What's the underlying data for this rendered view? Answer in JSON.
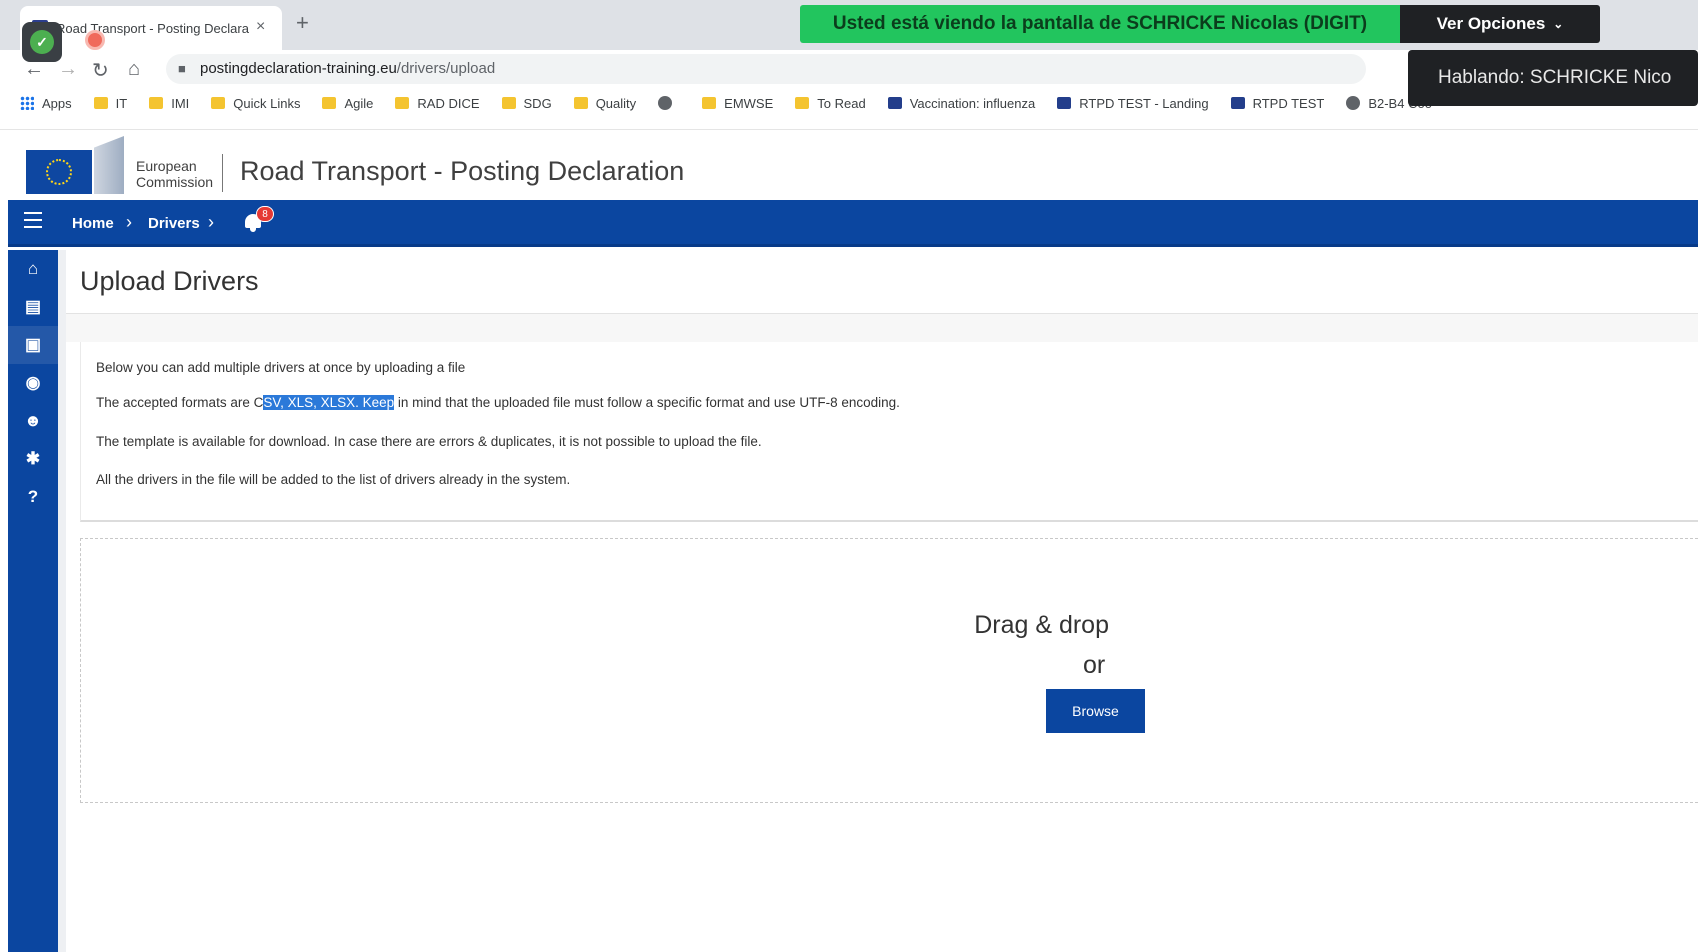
{
  "browser": {
    "tab_title": "Road Transport - Posting Declara",
    "tab_close": "×",
    "new_tab": "+",
    "url_host": "postingdeclaration-training.eu",
    "url_path": "/drivers/upload",
    "bookmarks": [
      {
        "label": "Apps",
        "icon": "apps-grid-icon"
      },
      {
        "label": "IT",
        "icon": "folder-icon"
      },
      {
        "label": "IMI",
        "icon": "folder-icon"
      },
      {
        "label": "Quick Links",
        "icon": "folder-icon"
      },
      {
        "label": "Agile",
        "icon": "folder-icon"
      },
      {
        "label": "RAD DICE",
        "icon": "folder-icon"
      },
      {
        "label": "SDG",
        "icon": "folder-icon"
      },
      {
        "label": "Quality",
        "icon": "folder-icon"
      },
      {
        "label": "",
        "icon": "globe-icon"
      },
      {
        "label": "EMWSE",
        "icon": "folder-icon"
      },
      {
        "label": "To Read",
        "icon": "folder-icon"
      },
      {
        "label": "Vaccination: influenza",
        "icon": "eu-flag-icon"
      },
      {
        "label": "RTPD TEST - Landing",
        "icon": "eu-flag-icon"
      },
      {
        "label": "RTPD TEST",
        "icon": "eu-flag-icon"
      },
      {
        "label": "B2-B4 Coo",
        "icon": "globe-icon"
      }
    ]
  },
  "screen_share": {
    "banner": "Usted está viendo la pantalla de SCHRICKE Nicolas (DIGIT)",
    "options_label": "Ver Opciones",
    "speaking": "Hablando: SCHRICKE Nico"
  },
  "site": {
    "org_line1": "European",
    "org_line2": "Commission",
    "title": "Road Transport - Posting Declaration"
  },
  "nav": {
    "home": "Home",
    "drivers": "Drivers",
    "notification_count": "8"
  },
  "sidebar": {
    "items": [
      {
        "icon": "home-icon",
        "glyph": "⌂"
      },
      {
        "icon": "document-icon",
        "glyph": "▤"
      },
      {
        "icon": "bus-icon",
        "glyph": "▣"
      },
      {
        "icon": "chat-icon",
        "glyph": "◉"
      },
      {
        "icon": "users-icon",
        "glyph": "☻"
      },
      {
        "icon": "gear-icon",
        "glyph": "✱"
      },
      {
        "icon": "help-icon",
        "glyph": "?"
      }
    ]
  },
  "page": {
    "title": "Upload Drivers",
    "line1": "Below you can add multiple drivers at once by uploading a file",
    "line2_a": "The accepted formats are C",
    "line2_highlight": "SV, XLS, XLSX. Keep",
    "line2_b": " in mind that the uploaded file must follow a specific format and use UTF-8 encoding.",
    "line3": "The template is available for download. In case there are errors & duplicates, it is not possible to upload the file.",
    "line4": "All the drivers in the file will be added to the list of drivers already in the system."
  },
  "dropzone": {
    "drag": "Drag & drop",
    "or": "or",
    "browse": "Browse"
  }
}
